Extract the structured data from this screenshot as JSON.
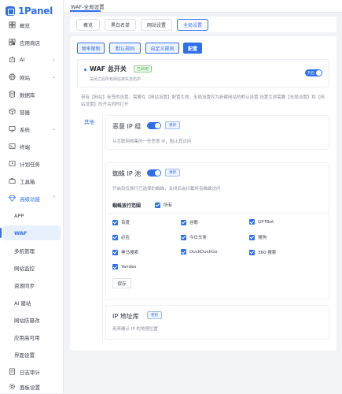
{
  "app": {
    "logo": "1Panel"
  },
  "sidebar": {
    "items": [
      {
        "label": "概览",
        "icon": "home-icon"
      },
      {
        "label": "应用商店",
        "icon": "store-icon"
      },
      {
        "label": "AI",
        "icon": "robot-icon",
        "chevron": "⌄"
      },
      {
        "label": "网站",
        "icon": "globe-icon",
        "chevron": "⌄"
      },
      {
        "label": "数据库",
        "icon": "database-icon"
      },
      {
        "label": "容器",
        "icon": "container-icon"
      },
      {
        "label": "系统",
        "icon": "system-icon",
        "chevron": "⌄"
      },
      {
        "label": "终端",
        "icon": "terminal-icon"
      },
      {
        "label": "计划任务",
        "icon": "clock-icon"
      },
      {
        "label": "工具箱",
        "icon": "toolbox-icon"
      },
      {
        "label": "高级功能",
        "icon": "diamond-icon",
        "chevron": "⌃"
      },
      {
        "label": "APP"
      },
      {
        "label": "WAF"
      },
      {
        "label": "多机管理"
      },
      {
        "label": "网站监控"
      },
      {
        "label": "资源同步"
      },
      {
        "label": "AI 建站"
      },
      {
        "label": "网站防篡改"
      },
      {
        "label": "应用高可用"
      },
      {
        "label": "界面设置"
      },
      {
        "label": "日志审计",
        "icon": "log-icon"
      },
      {
        "label": "面板设置",
        "icon": "settings-icon"
      }
    ]
  },
  "header": {
    "breadcrumb": "WAF-全局设置"
  },
  "tabs": [
    "概览",
    "黑白名单",
    "网站设置",
    "全局设置"
  ],
  "subtabs": [
    "频率限制",
    "默认规则",
    "自定义规则",
    "配置"
  ],
  "master": {
    "title": "WAF 总开关",
    "badge": "已启用",
    "desc": "关闭之后所有网站将失去防护",
    "toggle": "开启"
  },
  "notice": "带有【网站】标签的设置，需要在【网站设置】配置生效，全局设置仅为新建网站的默认设置 设置生效需要【全局设置】和【网站设置】的开关同时打开",
  "side_label": "其他",
  "sections": {
    "malicious": {
      "title": "恶意 IP 组",
      "update": "更新",
      "desc": "从互联网收集的一些恶意 IP，阻止其访问"
    },
    "spider": {
      "title": "蜘蛛 IP 池",
      "update": "更新",
      "desc": "开启后仅放行已选择的蜘蛛，关闭后会拦截所有蜘蛛访问",
      "range_label": "蜘蛛放行范围",
      "all_label": "所有",
      "options": [
        "百度",
        "谷歌",
        "GPTBot",
        "必应",
        "今日头条",
        "搜狗",
        "神马搜索",
        "DuckDuckGo",
        "360 搜索",
        "Yandex"
      ],
      "save": "保存"
    },
    "iplib": {
      "title": "IP 地址库",
      "update": "更新",
      "desc": "用来确认 IP 的地理位置"
    }
  },
  "colors": {
    "accent": "#2f6fec",
    "success": "#4caf50"
  }
}
